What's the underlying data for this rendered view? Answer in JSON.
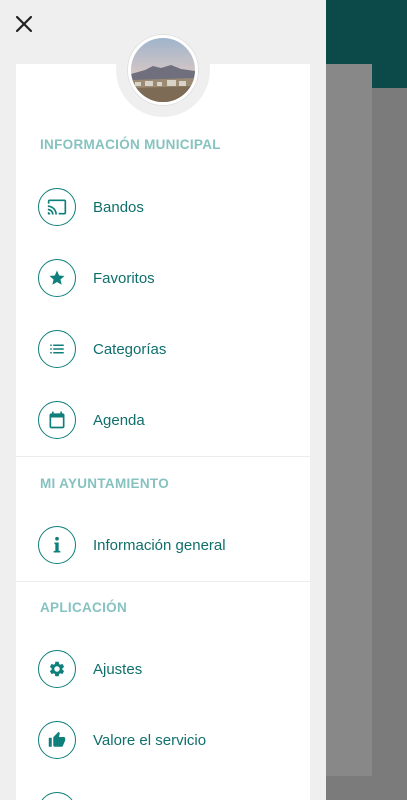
{
  "drawer": {
    "close_label": "✕",
    "sections": [
      {
        "title": "INFORMACIÓN MUNICIPAL",
        "items": [
          {
            "label": "Bandos",
            "icon": "cast-icon"
          },
          {
            "label": "Favoritos",
            "icon": "star-icon"
          },
          {
            "label": "Categorías",
            "icon": "list-icon"
          },
          {
            "label": "Agenda",
            "icon": "calendar-icon"
          }
        ]
      },
      {
        "title": "MI AYUNTAMIENTO",
        "items": [
          {
            "label": "Información general",
            "icon": "info-icon"
          }
        ]
      },
      {
        "title": "APLICACIÓN",
        "items": [
          {
            "label": "Ajustes",
            "icon": "gear-icon"
          },
          {
            "label": "Valore el servicio",
            "icon": "thumbs-up-icon"
          }
        ]
      }
    ]
  },
  "colors": {
    "accent": "#0f7f7b",
    "section_title": "#86c3c0",
    "header_bg": "#0b4a48"
  }
}
